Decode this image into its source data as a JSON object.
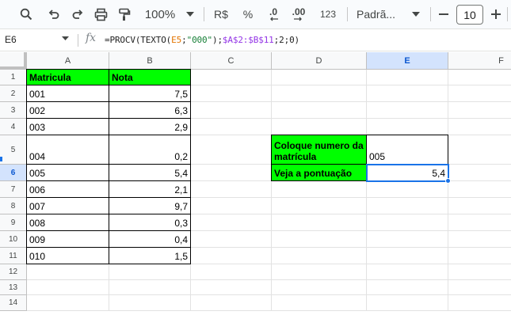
{
  "toolbar": {
    "zoom": "100%",
    "currency": "R$",
    "percent": "%",
    "dec_decrease": ".0",
    "dec_increase": ".00",
    "format_123": "123",
    "font_name": "Padrã...",
    "font_size": "10",
    "minus": "—",
    "plus": "+"
  },
  "formula_bar": {
    "cell_ref": "E6",
    "f_prefix": "=PROCV(TEXTO(",
    "f_ref": "E5",
    "f_sep1": ";",
    "f_str": "\"000\"",
    "f_mid": ");",
    "f_range": "$A$2:$B$11",
    "f_suffix": ";2;0)"
  },
  "columns": [
    "A",
    "B",
    "C",
    "D",
    "E",
    "F"
  ],
  "active_column": "E",
  "rows": [
    "1",
    "2",
    "3",
    "4",
    "5",
    "6",
    "7",
    "8",
    "9",
    "10",
    "11",
    "12",
    "13",
    "14"
  ],
  "active_row": "6",
  "table": {
    "header": [
      "Matricula",
      "Nota"
    ],
    "records": [
      [
        "001",
        "7,5"
      ],
      [
        "002",
        "6,3"
      ],
      [
        "003",
        "2,9"
      ],
      [
        "004",
        "0,2"
      ],
      [
        "005",
        "5,4"
      ],
      [
        "006",
        "2,1"
      ],
      [
        "007",
        "9,7"
      ],
      [
        "008",
        "0,3"
      ],
      [
        "009",
        "0,4"
      ],
      [
        "010",
        "1,5"
      ]
    ]
  },
  "lookup": {
    "label_input": "Coloque numero da matrícula",
    "input_value": "005",
    "label_result": "Veja a pontuação",
    "result_value": "5,4"
  },
  "colors": {
    "header_fill": "#00ff00",
    "selection": "#1a73e8"
  }
}
